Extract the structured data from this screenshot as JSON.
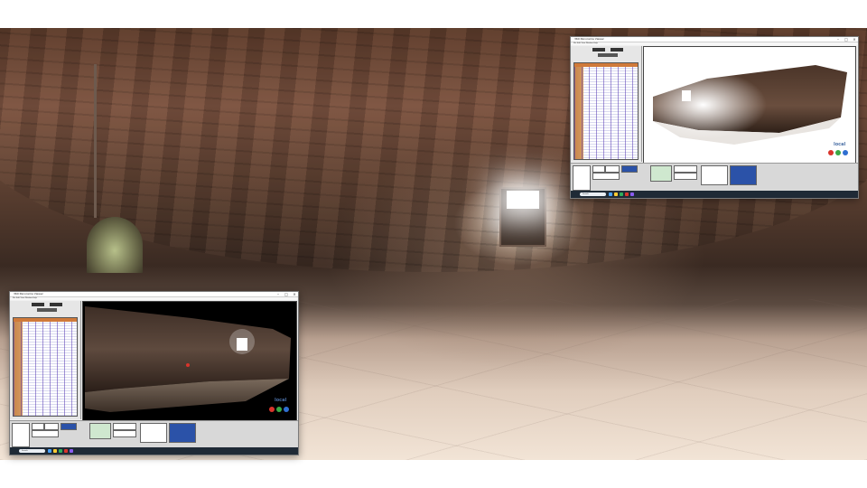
{
  "background": {
    "name": "panorama-vaulted-cellar"
  },
  "windows": {
    "top": {
      "title": "360 Panorama Viewer",
      "menu": "File  Edit  View  Window  Help",
      "view_label": "local",
      "taskbar_search": "Search",
      "clock_time": "",
      "clock_date": ""
    },
    "bottom": {
      "title": "360 Panorama Viewer",
      "menu": "File  Edit  View  Window  Help",
      "view_label": "local",
      "taskbar_search": "Search",
      "clock_time": "",
      "clock_date": ""
    }
  },
  "colors": {
    "camera_red": "#d9342b",
    "camera_green": "#3aa845",
    "camera_blue": "#2f6fd1",
    "camera_dark": "#333333",
    "list_accent": "#d07a3a"
  }
}
